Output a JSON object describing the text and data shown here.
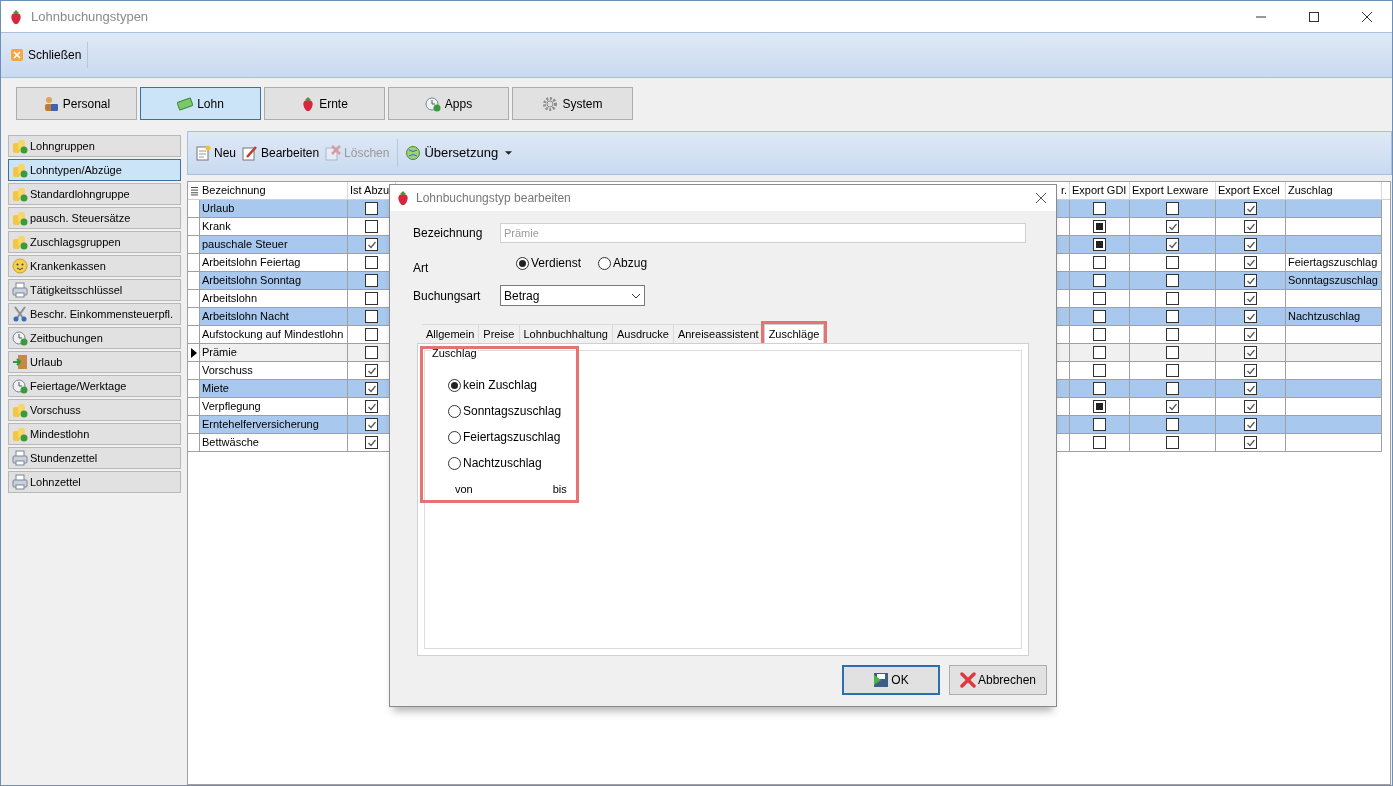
{
  "window": {
    "title": "Lohnbuchungstypen"
  },
  "ribbon": {
    "close_button": "Schließen"
  },
  "modules": [
    {
      "label": "Personal",
      "selected": false
    },
    {
      "label": "Lohn",
      "selected": true
    },
    {
      "label": "Ernte",
      "selected": false
    },
    {
      "label": "Apps",
      "selected": false
    },
    {
      "label": "System",
      "selected": false
    }
  ],
  "sidebar": {
    "items": [
      {
        "label": "Lohngruppen",
        "selected": false
      },
      {
        "label": "Lohntypen/Abzüge",
        "selected": true
      },
      {
        "label": "Standardlohngruppe",
        "selected": false
      },
      {
        "label": "pausch. Steuersätze",
        "selected": false
      },
      {
        "label": "Zuschlagsgruppen",
        "selected": false
      },
      {
        "label": "Krankenkassen",
        "selected": false
      },
      {
        "label": "Tätigkeitsschlüssel",
        "selected": false
      },
      {
        "label": "Beschr. Einkommensteuerpfl.",
        "selected": false
      },
      {
        "label": "Zeitbuchungen",
        "selected": false
      },
      {
        "label": "Urlaub",
        "selected": false
      },
      {
        "label": "Feiertage/Werktage",
        "selected": false
      },
      {
        "label": "Vorschuss",
        "selected": false
      },
      {
        "label": "Mindestlohn",
        "selected": false
      },
      {
        "label": "Stundenzettel",
        "selected": false
      },
      {
        "label": "Lohnzettel",
        "selected": false
      }
    ]
  },
  "toolbar": {
    "buttons": [
      {
        "label": "Neu",
        "disabled": false
      },
      {
        "label": "Bearbeiten",
        "disabled": false
      },
      {
        "label": "Löschen",
        "disabled": true
      }
    ],
    "translation": "Übersetzung"
  },
  "table": {
    "columns": [
      "Bezeichnung",
      "Ist Abzu",
      "r.",
      "Export GDI",
      "Export Lexware",
      "Export Excel",
      "Zuschlag"
    ],
    "rows": [
      {
        "bezeichnung": "Urlaub",
        "ist_abzug": false,
        "export_gdi": false,
        "export_lexware": false,
        "export_excel": true,
        "selected": true,
        "current": false
      },
      {
        "bezeichnung": "Krank",
        "ist_abzug": false,
        "export_gdi": true,
        "export_lexware": true,
        "export_excel": true,
        "selected": false,
        "current": false
      },
      {
        "bezeichnung": "pauschale Steuer",
        "ist_abzug": true,
        "export_gdi": true,
        "export_lexware": true,
        "export_excel": true,
        "selected": true,
        "current": false
      },
      {
        "bezeichnung": "Arbeitslohn Feiertag",
        "ist_abzug": false,
        "export_gdi": false,
        "export_lexware": false,
        "export_excel": true,
        "zuschlag": "Feiertagszuschlag",
        "selected": false,
        "current": false
      },
      {
        "bezeichnung": "Arbeitslohn Sonntag",
        "ist_abzug": false,
        "export_gdi": false,
        "export_lexware": false,
        "export_excel": true,
        "zuschlag": "Sonntagszuschlag",
        "selected": true,
        "current": false
      },
      {
        "bezeichnung": "Arbeitslohn",
        "ist_abzug": false,
        "export_gdi": false,
        "export_lexware": false,
        "export_excel": true,
        "selected": false,
        "current": false
      },
      {
        "bezeichnung": "Arbeitslohn Nacht",
        "ist_abzug": false,
        "export_gdi": false,
        "export_lexware": false,
        "export_excel": true,
        "zuschlag": "Nachtzuschlag",
        "selected": true,
        "current": false
      },
      {
        "bezeichnung": "Aufstockung auf Mindestlohn",
        "ist_abzug": false,
        "export_gdi": false,
        "export_lexware": false,
        "export_excel": true,
        "selected": false,
        "current": false
      },
      {
        "bezeichnung": "Prämie",
        "ist_abzug": false,
        "export_gdi": false,
        "export_lexware": false,
        "export_excel": true,
        "selected": false,
        "current": true
      },
      {
        "bezeichnung": "Vorschuss",
        "ist_abzug": true,
        "export_gdi": false,
        "export_lexware": false,
        "export_excel": true,
        "selected": false,
        "current": false
      },
      {
        "bezeichnung": "Miete",
        "ist_abzug": true,
        "export_gdi": false,
        "export_lexware": false,
        "export_excel": true,
        "selected": true,
        "current": false
      },
      {
        "bezeichnung": "Verpflegung",
        "ist_abzug": true,
        "export_gdi": true,
        "export_lexware": true,
        "export_excel": true,
        "selected": false,
        "current": false
      },
      {
        "bezeichnung": "Erntehelferversicherung",
        "ist_abzug": true,
        "export_gdi": false,
        "export_lexware": false,
        "export_excel": true,
        "selected": true,
        "current": false
      },
      {
        "bezeichnung": "Bettwäsche",
        "ist_abzug": true,
        "export_gdi": false,
        "export_lexware": false,
        "export_excel": true,
        "selected": false,
        "current": false
      }
    ]
  },
  "dialog": {
    "title": "Lohnbuchungstyp bearbeiten",
    "bezeichnung": {
      "label": "Bezeichnung",
      "value": "Prämie",
      "disabled": true
    },
    "art": {
      "label": "Art",
      "options": [
        {
          "label": "Verdienst",
          "selected": true
        },
        {
          "label": "Abzug",
          "selected": false
        }
      ]
    },
    "buchungsart": {
      "label": "Buchungsart",
      "value": "Betrag"
    },
    "tabs": [
      {
        "label": "Allgemein",
        "selected": false,
        "highlighted": false
      },
      {
        "label": "Preise",
        "selected": false,
        "highlighted": false
      },
      {
        "label": "Lohnbuchhaltung",
        "selected": false,
        "highlighted": false
      },
      {
        "label": "Ausdrucke",
        "selected": false,
        "highlighted": false
      },
      {
        "label": "Anreiseassistent",
        "selected": false,
        "highlighted": false
      },
      {
        "label": "Zuschläge",
        "selected": true,
        "highlighted": true
      }
    ],
    "zuschlag_group": {
      "title": "Zuschlag",
      "highlighted": true,
      "options": [
        {
          "label": "kein Zuschlag",
          "selected": true
        },
        {
          "label": "Sonntagszuschlag",
          "selected": false
        },
        {
          "label": "Feiertagszuschlag",
          "selected": false
        },
        {
          "label": "Nachtzuschlag",
          "selected": false
        }
      ],
      "von": "von",
      "bis": "bis"
    },
    "buttons": [
      {
        "label": "OK",
        "default": true
      },
      {
        "label": "Abbrechen",
        "default": false
      }
    ]
  }
}
